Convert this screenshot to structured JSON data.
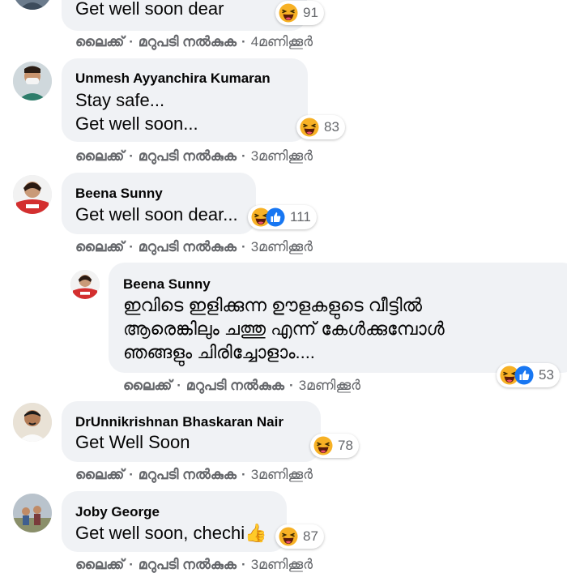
{
  "actions": {
    "like": "ലൈക്ക്",
    "reply": "മറുപടി നൽകുക",
    "separator": "·"
  },
  "colors": {
    "bubble": "#f0f2f5",
    "action_text": "#65676b",
    "haha_face": "#f7b125",
    "like_blue": "#1877f2"
  },
  "comments": [
    {
      "text_lines": [
        "Get well soon dear"
      ],
      "reactions": [
        "haha-icon"
      ],
      "count": "91",
      "time": "4മണിക്കൂർ"
    },
    {
      "author": "Unmesh Ayyanchira Kumaran",
      "text_lines": [
        "Stay safe...",
        "Get well soon..."
      ],
      "reactions": [
        "haha-icon"
      ],
      "count": "83",
      "time": "3മണിക്കൂർ"
    },
    {
      "author": "Beena Sunny",
      "text_lines": [
        "Get well soon dear..."
      ],
      "reactions": [
        "haha-icon",
        "like-icon"
      ],
      "count": "111",
      "time": "3മണിക്കൂർ"
    },
    {
      "author": "Beena Sunny",
      "is_reply": true,
      "text_lines": [
        "ഇവിടെ ഇളിക്കുന്ന ഊളകളുടെ വീട്ടിൽ",
        "ആരെങ്കിലും ചത്തു എന്ന് കേൾക്കുമ്പോൾ",
        "ഞങ്ങളും ചിരിച്ചോളാം...."
      ],
      "reactions": [
        "haha-icon",
        "like-icon"
      ],
      "count": "53",
      "time": "3മണിക്കൂർ"
    },
    {
      "author": "DrUnnikrishnan Bhaskaran Nair",
      "text_lines": [
        "Get Well Soon"
      ],
      "reactions": [
        "haha-icon"
      ],
      "count": "78",
      "time": "3മണിക്കൂർ"
    },
    {
      "author": "Joby George",
      "text_lines": [
        "Get well soon, chechi👍"
      ],
      "reactions": [
        "haha-icon"
      ],
      "count": "87",
      "time": "3മണിക്കൂർ"
    }
  ]
}
